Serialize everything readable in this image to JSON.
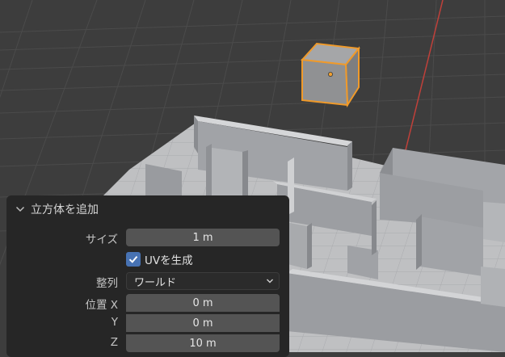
{
  "panel": {
    "title": "立方体を追加",
    "size": {
      "label": "サイズ",
      "value": "1 m"
    },
    "generate_uvs": {
      "label": "UVを生成",
      "checked": true
    },
    "align": {
      "label": "整列",
      "value": "ワールド"
    },
    "location": {
      "label_x": "位置 X",
      "label_y": "Y",
      "label_z": "Z",
      "x": "0 m",
      "y": "0 m",
      "z": "10 m"
    }
  },
  "colors": {
    "viewport_bg": "#3d3d3d",
    "grid_line": "#4a4a4a",
    "x_axis": "#c0403a",
    "selection_outline": "#f09a2a",
    "panel_bg": "#262626",
    "field_bg": "#545454",
    "checkbox": "#4772b3"
  }
}
